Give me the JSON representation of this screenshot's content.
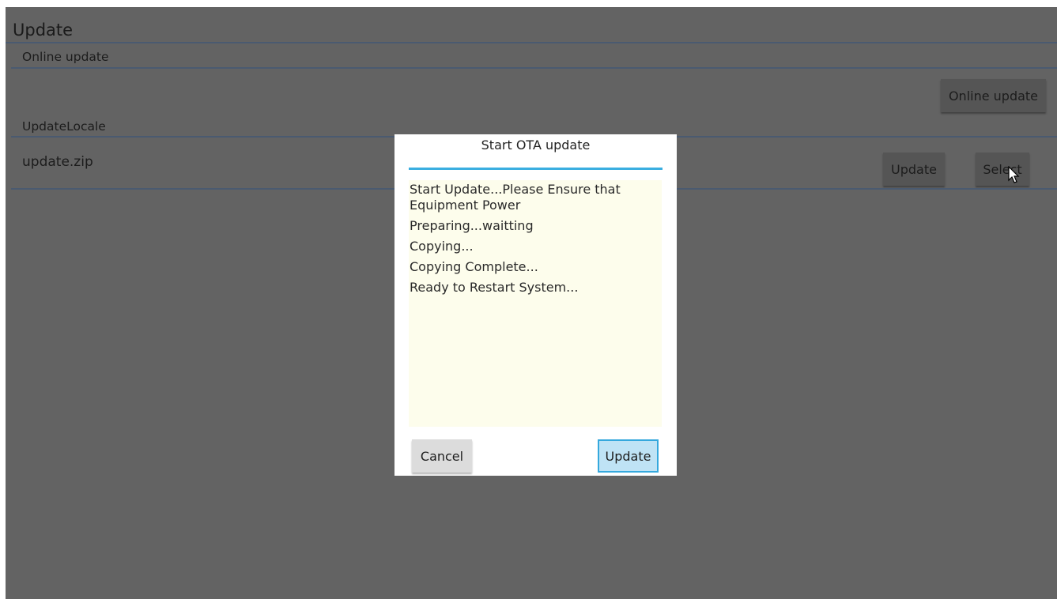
{
  "page": {
    "title": "Update",
    "online_section_label": "Online update",
    "online_update_button": "Online update",
    "local_section_label": "UpdateLocale",
    "file_name": "update.zip",
    "update_button": "Update",
    "select_button": "Select"
  },
  "dialog": {
    "title": "Start OTA update",
    "log_lines": [
      "Start Update...Please Ensure that Equipment Power",
      "Preparing...waitting",
      "Copying...",
      "Copying Complete...",
      "Ready to Restart System..."
    ],
    "cancel_button": "Cancel",
    "update_button": "Update"
  },
  "colors": {
    "overlay": "#636363",
    "accent": "#3aaee0",
    "log_background": "#fdfdec"
  }
}
